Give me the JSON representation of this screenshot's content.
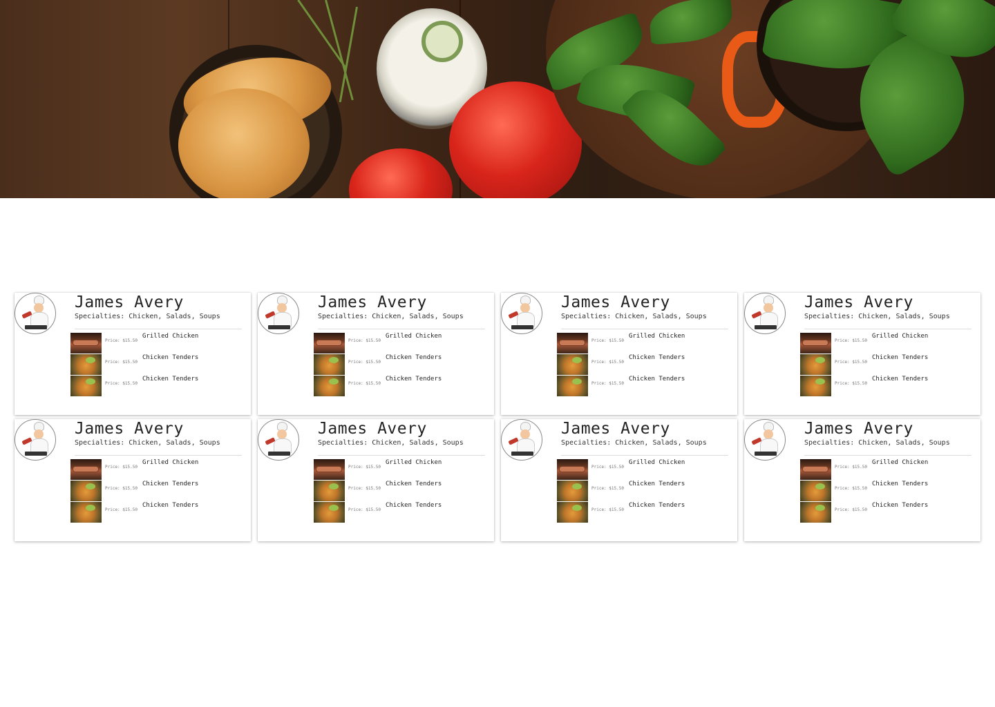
{
  "hero": {
    "icon": "food-banner-image"
  },
  "cards": [
    {
      "name": "James Avery",
      "specialties": "Specialties: Chicken, Salads, Soups",
      "items": [
        {
          "name": "Grilled Chicken",
          "price": "Price: $15.50",
          "thumb": "grill"
        },
        {
          "name": "Chicken Tenders",
          "price": "Price: $15.50",
          "thumb": "tender"
        },
        {
          "name": "Chicken Tenders",
          "price": "Price: $15.50",
          "thumb": "tender"
        }
      ]
    },
    {
      "name": "James Avery",
      "specialties": "Specialties: Chicken, Salads, Soups",
      "items": [
        {
          "name": "Grilled Chicken",
          "price": "Price: $15.50",
          "thumb": "grill"
        },
        {
          "name": "Chicken Tenders",
          "price": "Price: $15.50",
          "thumb": "tender"
        },
        {
          "name": "Chicken Tenders",
          "price": "Price: $15.50",
          "thumb": "tender"
        }
      ]
    },
    {
      "name": "James Avery",
      "specialties": "Specialties: Chicken, Salads, Soups",
      "items": [
        {
          "name": "Grilled Chicken",
          "price": "Price: $15.50",
          "thumb": "grill"
        },
        {
          "name": "Chicken Tenders",
          "price": "Price: $15.50",
          "thumb": "tender"
        },
        {
          "name": "Chicken Tenders",
          "price": "Price: $15.50",
          "thumb": "tender"
        }
      ]
    },
    {
      "name": "James Avery",
      "specialties": "Specialties: Chicken, Salads, Soups",
      "items": [
        {
          "name": "Grilled Chicken",
          "price": "Price: $15.50",
          "thumb": "grill"
        },
        {
          "name": "Chicken Tenders",
          "price": "Price: $15.50",
          "thumb": "tender"
        },
        {
          "name": "Chicken Tenders",
          "price": "Price: $15.50",
          "thumb": "tender"
        }
      ]
    },
    {
      "name": "James Avery",
      "specialties": "Specialties: Chicken, Salads, Soups",
      "items": [
        {
          "name": "Grilled Chicken",
          "price": "Price: $15.50",
          "thumb": "grill"
        },
        {
          "name": "Chicken Tenders",
          "price": "Price: $15.50",
          "thumb": "tender"
        },
        {
          "name": "Chicken Tenders",
          "price": "Price: $15.50",
          "thumb": "tender"
        }
      ]
    },
    {
      "name": "James Avery",
      "specialties": "Specialties: Chicken, Salads, Soups",
      "items": [
        {
          "name": "Grilled Chicken",
          "price": "Price: $15.50",
          "thumb": "grill"
        },
        {
          "name": "Chicken Tenders",
          "price": "Price: $15.50",
          "thumb": "tender"
        },
        {
          "name": "Chicken Tenders",
          "price": "Price: $15.50",
          "thumb": "tender"
        }
      ]
    },
    {
      "name": "James Avery",
      "specialties": "Specialties: Chicken, Salads, Soups",
      "items": [
        {
          "name": "Grilled Chicken",
          "price": "Price: $15.50",
          "thumb": "grill"
        },
        {
          "name": "Chicken Tenders",
          "price": "Price: $15.50",
          "thumb": "tender"
        },
        {
          "name": "Chicken Tenders",
          "price": "Price: $15.50",
          "thumb": "tender"
        }
      ]
    },
    {
      "name": "James Avery",
      "specialties": "Specialties: Chicken, Salads, Soups",
      "items": [
        {
          "name": "Grilled Chicken",
          "price": "Price: $15.50",
          "thumb": "grill"
        },
        {
          "name": "Chicken Tenders",
          "price": "Price: $15.50",
          "thumb": "tender"
        },
        {
          "name": "Chicken Tenders",
          "price": "Price: $15.50",
          "thumb": "tender"
        }
      ]
    }
  ]
}
